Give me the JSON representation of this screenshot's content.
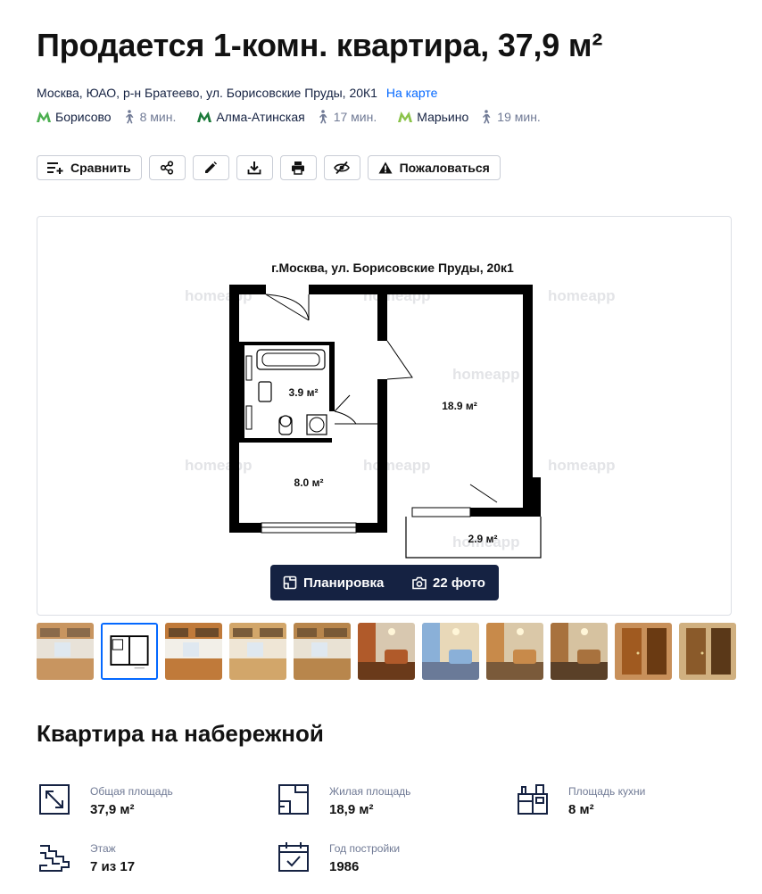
{
  "header": {
    "title": "Продается 1-комн. квартира, 37,9 м²"
  },
  "address": {
    "text": "Москва, ЮАО, р-н Братеево, ул. Борисовские Пруды, 20К1",
    "map_link": "На карте"
  },
  "metro": [
    {
      "name": "Борисово",
      "time": "8 мин.",
      "color": "#4caf50"
    },
    {
      "name": "Алма-Атинская",
      "time": "17 мин.",
      "color": "#1b7a3a"
    },
    {
      "name": "Марьино",
      "time": "19 мин.",
      "color": "#8bc34a"
    }
  ],
  "actions": {
    "compare": "Сравнить",
    "complain": "Пожаловаться"
  },
  "gallery": {
    "plan_caption": "г.Москва, ул. Борисовские Пруды, 20к1",
    "watermark": "homeapp",
    "rooms": {
      "bath": "3.9 м²",
      "room": "18.9 м²",
      "kitchen": "8.0 м²",
      "balcony": "2.9 м²"
    },
    "switch_plan": "Планировка",
    "switch_photos": "22 фото"
  },
  "thumbnails": [
    {
      "kind": "kitchen",
      "palette": [
        "#c89560",
        "#e8e2d8",
        "#8a6a4a"
      ]
    },
    {
      "kind": "plan",
      "palette": [
        "#ffffff",
        "#000000",
        "#dddddd"
      ]
    },
    {
      "kind": "kitchen",
      "palette": [
        "#c07a3a",
        "#f2efe8",
        "#6b4a2a"
      ]
    },
    {
      "kind": "kitchen",
      "palette": [
        "#d2a66a",
        "#efe6d6",
        "#7a5c3a"
      ]
    },
    {
      "kind": "kitchen",
      "palette": [
        "#b8864c",
        "#e9e2d4",
        "#7a5a36"
      ]
    },
    {
      "kind": "room",
      "palette": [
        "#b05a2a",
        "#d8c8b0",
        "#6a3a1a"
      ]
    },
    {
      "kind": "room",
      "palette": [
        "#8ab0d8",
        "#e8d8b8",
        "#6a7a98"
      ]
    },
    {
      "kind": "room",
      "palette": [
        "#c88a4a",
        "#dac8a8",
        "#7a5a3a"
      ]
    },
    {
      "kind": "room",
      "palette": [
        "#a8723e",
        "#d6c2a0",
        "#5a4028"
      ]
    },
    {
      "kind": "hall",
      "palette": [
        "#a05a20",
        "#c8905a",
        "#6a3a12"
      ]
    },
    {
      "kind": "hall",
      "palette": [
        "#8a5a2a",
        "#d0b080",
        "#5a3818"
      ]
    }
  ],
  "section": {
    "title": "Квартира на набережной"
  },
  "facts": {
    "total_area": {
      "label": "Общая площадь",
      "value": "37,9 м²"
    },
    "living_area": {
      "label": "Жилая площадь",
      "value": "18,9 м²"
    },
    "kitchen_area": {
      "label": "Площадь кухни",
      "value": "8 м²"
    },
    "floor": {
      "label": "Этаж",
      "value": "7 из 17"
    },
    "year": {
      "label": "Год постройки",
      "value": "1986"
    }
  }
}
